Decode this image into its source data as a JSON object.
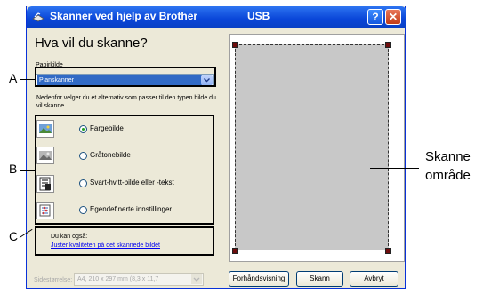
{
  "window": {
    "title": "Skanner ved hjelp av Brother",
    "subtitle": "USB",
    "help_label": "?",
    "close_label": "✕"
  },
  "main": {
    "heading": "Hva vil du skanne?",
    "paper_source_label": "Papirkilde",
    "paper_source_value": "Planskanner",
    "description": "Nedenfor velger du et alternativ som passer til den typen bilde du vil skanne.",
    "options": [
      {
        "label": "Fargebilde",
        "icon": "color-picture-icon",
        "selected": true
      },
      {
        "label": "Gråtonebilde",
        "icon": "grayscale-picture-icon",
        "selected": false
      },
      {
        "label": "Svart-hvitt-bilde eller -tekst",
        "icon": "black-white-text-icon",
        "selected": false
      },
      {
        "label": "Egendefinerte innstillinger",
        "icon": "custom-settings-icon",
        "selected": false
      }
    ],
    "also_label": "Du kan også:",
    "adjust_link": "Juster kvaliteten på det skannede bildet"
  },
  "footer": {
    "page_size_label": "Sidestørrelse:",
    "page_size_value": "A4, 210 x 297 mm (8,3 x 11,7",
    "preview_button": "Forhåndsvisning",
    "scan_button": "Skann",
    "cancel_button": "Avbryt"
  },
  "annotations": {
    "a": "A",
    "b": "B",
    "c": "C",
    "scan_area_line1": "Skanne",
    "scan_area_line2": "område"
  },
  "colors": {
    "title_bar": "#0a46d8",
    "window_bg": "#ece9d8",
    "selection": "#316ac5",
    "scan_area": "#c8c8c8",
    "link": "#0000ee"
  }
}
